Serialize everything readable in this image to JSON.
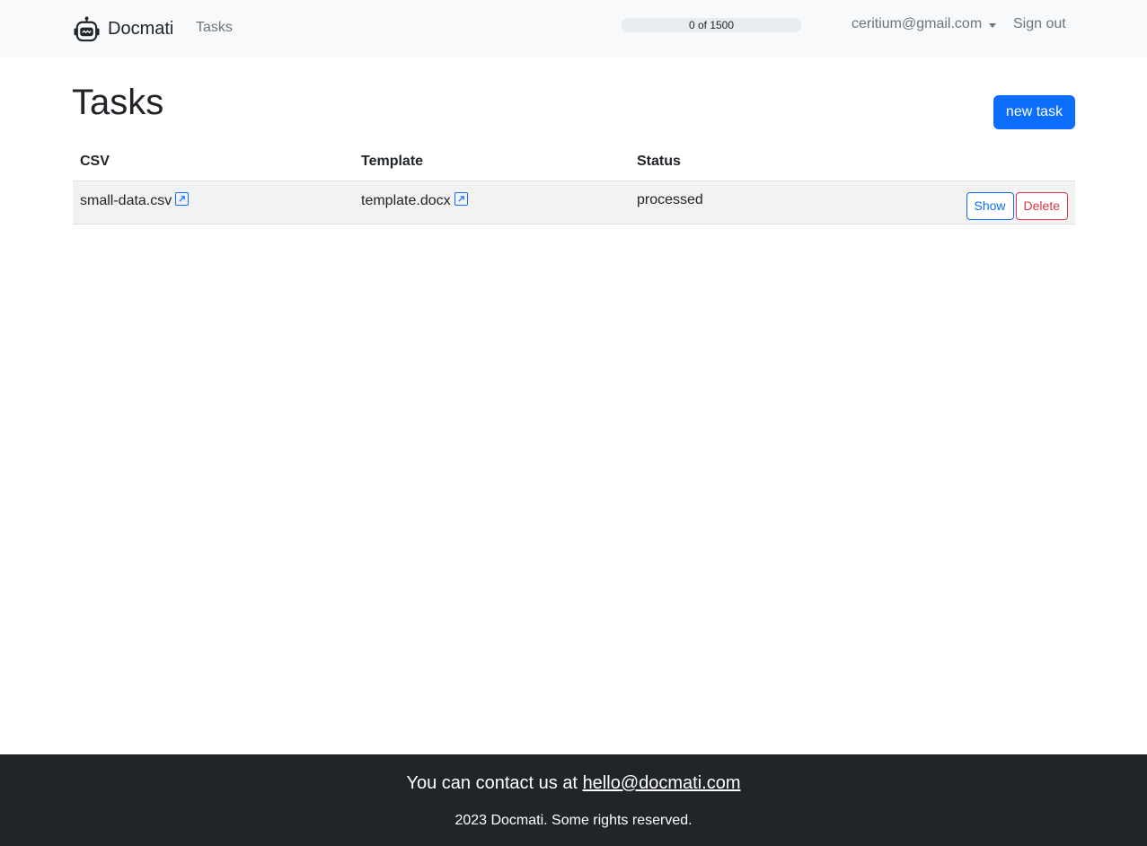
{
  "navbar": {
    "brand": "Docmati",
    "brand_icon": "robot-icon",
    "nav_tasks": "Tasks",
    "quota": {
      "used": 0,
      "total": 1500,
      "text": "0 of 1500"
    },
    "user_email": "ceritium@gmail.com",
    "sign_out": "Sign out"
  },
  "main": {
    "title": "Tasks",
    "new_task_label": "new task",
    "table": {
      "headers": {
        "csv": "CSV",
        "template": "Template",
        "status": "Status"
      },
      "rows": [
        {
          "csv": "small-data.csv",
          "template": "template.docx",
          "status": "processed",
          "show_label": "Show",
          "delete_label": "Delete"
        }
      ]
    }
  },
  "footer": {
    "contact_prefix": "You can contact us at",
    "contact_email": "hello@docmati.com",
    "copyright": "2023 Docmati. Some rights reserved."
  },
  "colors": {
    "primary": "#0d6efd",
    "danger": "#dc3545",
    "navbar_bg": "#f8f9fa",
    "footer_bg": "#212529"
  }
}
